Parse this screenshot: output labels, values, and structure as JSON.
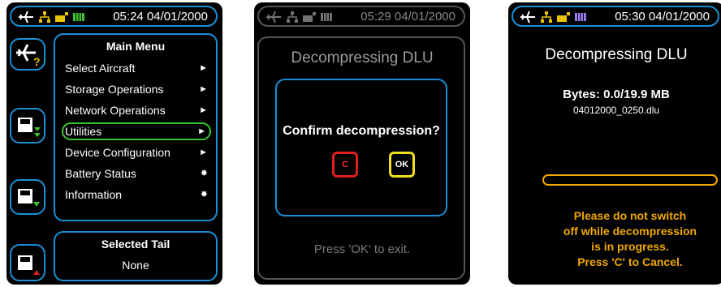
{
  "colors": {
    "frame": "#1a8fd6",
    "selected": "#39c52f",
    "warning": "#f0a800",
    "cancel": "#e02020",
    "ok": "#f0e020"
  },
  "status_icons": [
    "airplane-icon",
    "network-icon",
    "power-plug-icon",
    "battery-icon"
  ],
  "screen1": {
    "time": "05:24 04/01/2000",
    "menu": {
      "title": "Main Menu",
      "items": [
        {
          "label": "Select Aircraft",
          "indicator": "►"
        },
        {
          "label": "Storage Operations",
          "indicator": "►"
        },
        {
          "label": "Network Operations",
          "indicator": "►"
        },
        {
          "label": "Utilities",
          "indicator": "►"
        },
        {
          "label": "Device Configuration",
          "indicator": "►"
        },
        {
          "label": "Battery Status",
          "indicator": "✸"
        },
        {
          "label": "Information",
          "indicator": "✸"
        }
      ],
      "selected": "Utilities"
    },
    "side_buttons": [
      "aircraft-help-icon",
      "save-download-icon",
      "save-down-icon",
      "save-up-icon"
    ],
    "selected_tail": {
      "title": "Selected Tail",
      "value": "None"
    }
  },
  "screen2": {
    "time": "05:29 04/01/2000",
    "title": "Decompressing DLU",
    "dialog": {
      "message": "Confirm decompression?",
      "cancel_key": "C",
      "ok_key": "OK"
    },
    "hint": "Press 'OK' to exit."
  },
  "screen3": {
    "time": "05:30 04/01/2000",
    "title": "Decompressing DLU",
    "bytes": "Bytes: 0.0/19.9 MB",
    "filename": "04012000_0250.dlu",
    "progress": 0,
    "warning_lines": [
      "Please do not switch",
      "off while decompression",
      "is in progress.",
      "Press 'C' to Cancel."
    ]
  }
}
